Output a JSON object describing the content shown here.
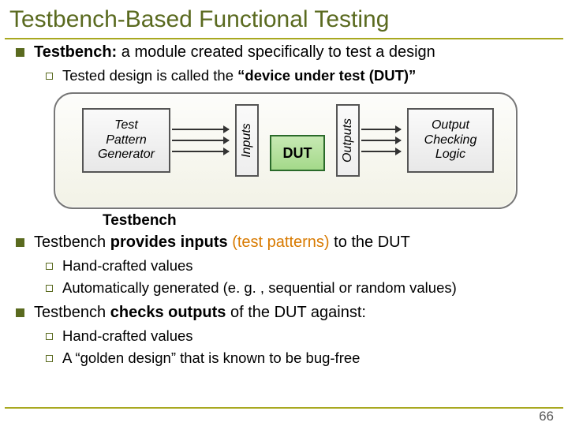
{
  "title": "Testbench-Based Functional Testing",
  "bullets": {
    "tb_def_pre": "Testbench:",
    "tb_def_post": " a module created specifically to test a design",
    "sub_dut_pre": "Tested design is called the ",
    "sub_dut_bold": "“device under test (DUT)”",
    "tb_provides_pre": "Testbench ",
    "tb_provides_bold": "provides inputs",
    "tb_provides_paren": " (test patterns)",
    "tb_provides_post": " to the DUT",
    "handcrafted": "Hand-crafted values",
    "autogen": "Automatically generated (e. g. , sequential or random values)",
    "tb_checks_pre": "Testbench ",
    "tb_checks_bold": "checks outputs",
    "tb_checks_post": " of the DUT against:",
    "golden": "A “golden design” that is known to be bug-free"
  },
  "diagram": {
    "tpg": "Test\nPattern\nGenerator",
    "inputs": "Inputs",
    "dut": "DUT",
    "outputs": "Outputs",
    "ocl": "Output\nChecking\nLogic",
    "tb_label": "Testbench"
  },
  "page": "66"
}
